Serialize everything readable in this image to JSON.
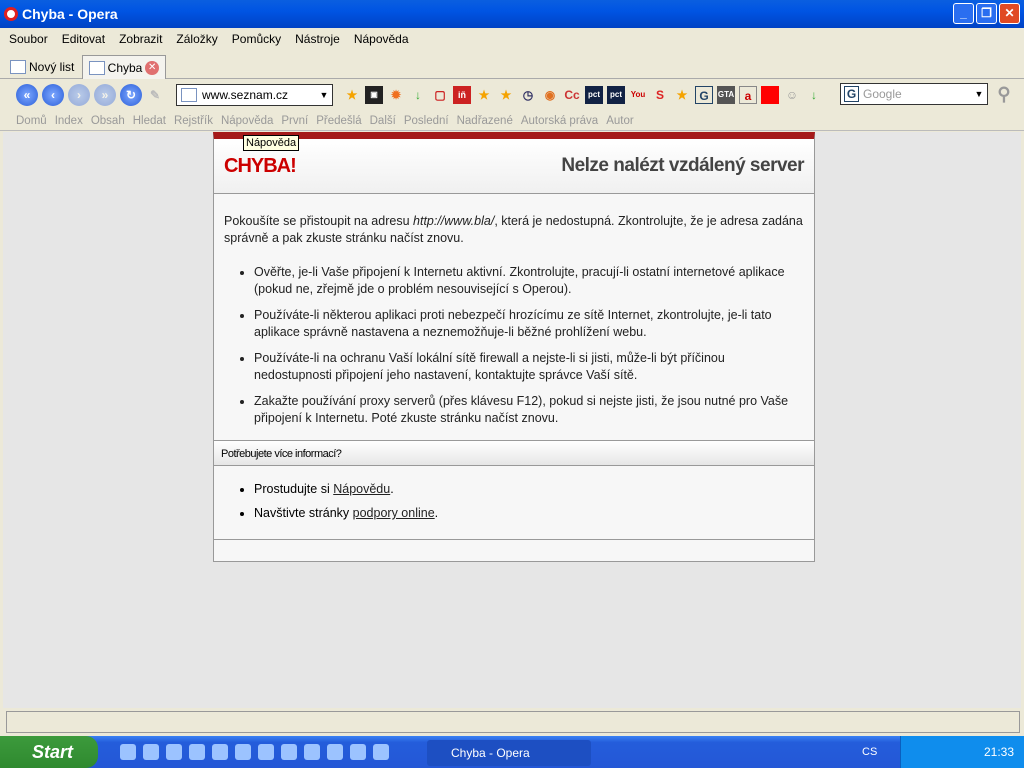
{
  "window": {
    "title": "Chyba - Opera"
  },
  "menu": [
    "Soubor",
    "Editovat",
    "Zobrazit",
    "Záložky",
    "Pomůcky",
    "Nástroje",
    "Nápověda"
  ],
  "tabs": [
    {
      "label": "Nový list"
    },
    {
      "label": "Chyba"
    }
  ],
  "address": {
    "value": "www.seznam.cz"
  },
  "search": {
    "placeholder": "Google",
    "engine_icon": "G"
  },
  "navbar": [
    "Domů",
    "Index",
    "Obsah",
    "Hledat",
    "Rejstřík",
    "Nápověda",
    "První",
    "Předešlá",
    "Další",
    "Poslední",
    "Nadřazené",
    "Autorská práva",
    "Autor"
  ],
  "tooltip": "Nápověda",
  "page": {
    "error_label": "CHYBA!",
    "title": "Nelze nalézt vzdálený server",
    "intro_pre": "Pokoušíte se přistoupit na adresu ",
    "intro_url": "http://www.bla/",
    "intro_post": ", která je nedostupná. Zkontrolujte, že je adresa zadána správně a pak zkuste stránku načíst znovu.",
    "bullets": [
      "Ověřte, je-li Vaše připojení k Internetu aktivní. Zkontrolujte, pracují-li ostatní internetové aplikace (pokud ne, zřejmě jde o problém nesouvisející s Operou).",
      "Používáte-li některou aplikaci proti nebezpečí hrozícímu ze sítě Internet, zkontrolujte, je-li tato aplikace správně nastavena a neznemožňuje-li běžné prohlížení webu.",
      "Používáte-li na ochranu Vaší lokální sítě firewall a nejste-li si jisti, může-li být příčinou nedostupnosti připojení jeho nastavení, kontaktujte správce Vaší sítě.",
      "Zakažte používání proxy serverů (přes klávesu F12), pokud si nejste jisti, že jsou nutné pro Vaše připojení k Internetu. Poté zkuste stránku načíst znovu."
    ],
    "more_info": "Potřebujete více informací?",
    "help_pre": "Prostudujte si ",
    "help_link": "Nápovědu",
    "help_post": ".",
    "support_pre": "Navštivte stránky ",
    "support_link": "podpory online",
    "support_post": "."
  },
  "taskbar": {
    "start": "Start",
    "task": "Chyba - Opera",
    "lang": "CS",
    "clock": "21:33"
  }
}
